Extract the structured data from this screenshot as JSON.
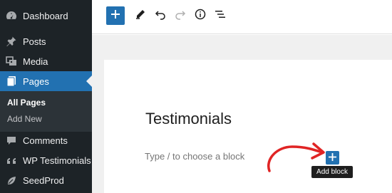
{
  "sidebar": {
    "items": [
      {
        "label": "Dashboard",
        "icon": "dashboard-icon"
      },
      {
        "label": "Posts",
        "icon": "pin-icon"
      },
      {
        "label": "Media",
        "icon": "media-icon"
      },
      {
        "label": "Pages",
        "icon": "pages-icon",
        "active": true
      },
      {
        "label": "Comments",
        "icon": "comment-icon"
      },
      {
        "label": "WP Testimonials",
        "icon": "quote-icon"
      },
      {
        "label": "SeedProd",
        "icon": "leaf-icon"
      }
    ],
    "submenu": [
      {
        "label": "All Pages",
        "current": true
      },
      {
        "label": "Add New"
      }
    ]
  },
  "toolbar": {
    "icons": [
      "plus-icon",
      "pencil-icon",
      "undo-icon",
      "redo-icon",
      "info-icon",
      "list-view-icon"
    ]
  },
  "editor": {
    "title": "Testimonials",
    "placeholder": "Type / to choose a block",
    "add_block_tooltip": "Add block"
  },
  "colors": {
    "sidebar_bg": "#1d2327",
    "active": "#2271b1",
    "annotation_arrow": "#e02424"
  }
}
